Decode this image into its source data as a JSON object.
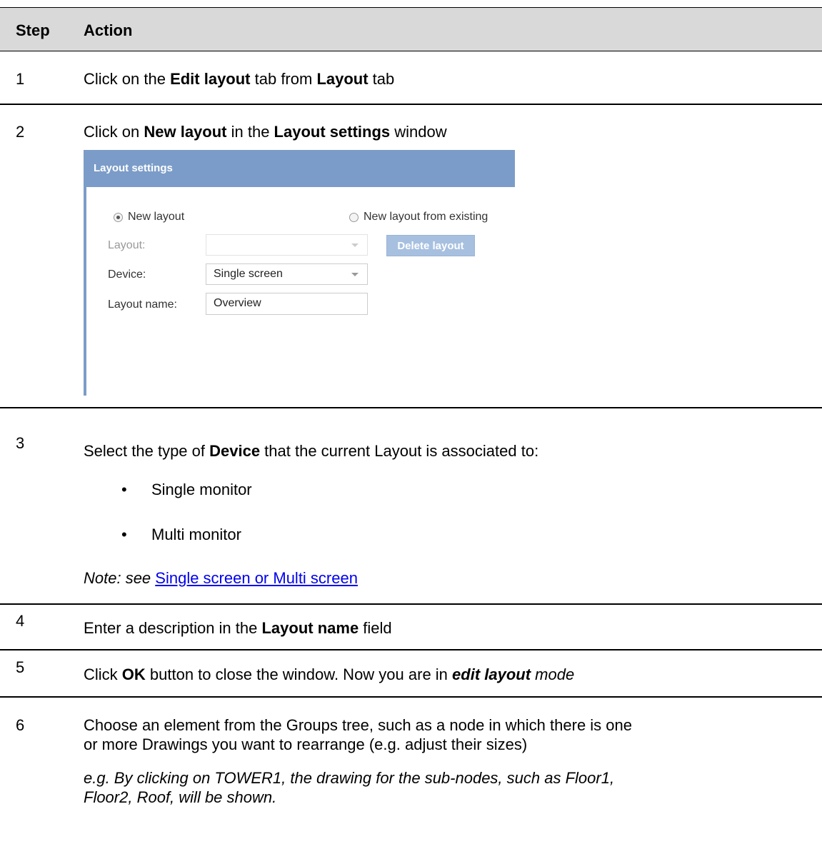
{
  "header": {
    "step": "Step",
    "action": "Action"
  },
  "row1": {
    "num": "1",
    "pre": "Click on the ",
    "b1": "Edit layout",
    "mid": " tab from ",
    "b2": "Layout",
    "post": " tab"
  },
  "row2": {
    "num": "2",
    "pre": "Click on ",
    "b1": "New layout",
    "mid": " in the ",
    "b2": "Layout settings",
    "post": " window"
  },
  "window": {
    "title": "Layout settings",
    "radio_new": "New layout",
    "radio_existing": "New layout from existing",
    "layout_label": "Layout:",
    "layout_value": "",
    "delete_button": "Delete layout",
    "device_label": "Device:",
    "device_value": "Single screen",
    "name_label": "Layout name:",
    "name_value": "Overview"
  },
  "row3": {
    "num": "3",
    "pre": "Select the type of ",
    "b1": "Device",
    "post": " that the current Layout is associated to:",
    "bullets": [
      "Single monitor",
      "Multi monitor"
    ],
    "note": "Note: see ",
    "link": "Single screen or Multi screen"
  },
  "row4": {
    "num": "4",
    "pre": "Enter a description in the ",
    "b1": "Layout name",
    "post": " field"
  },
  "row5": {
    "num": "5",
    "pre": "Click ",
    "b1": "OK",
    "mid": " button to close the window. Now you are in ",
    "bi": "edit layout",
    "post": " mode"
  },
  "row6": {
    "num": "6",
    "line1": "Choose an element from the Groups tree, such as a node in which there is one",
    "line2": "or more Drawings you want to rearrange (e.g. adjust their sizes)",
    "ex1": "e.g. By clicking on TOWER1, the drawing for the sub-nodes, such as Floor1,",
    "ex2": "Floor2, Roof, will be shown."
  }
}
